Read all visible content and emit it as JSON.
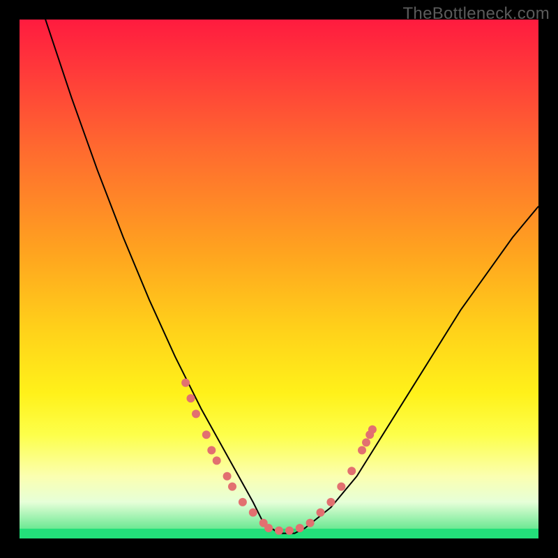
{
  "watermark": "TheBottleneck.com",
  "colors": {
    "gradient_top": "#ff1b3f",
    "gradient_bottom": "#3fe07a",
    "curve": "#000000",
    "points": "#e27070",
    "frame_bg": "#000000"
  },
  "chart_data": {
    "type": "line",
    "title": "",
    "xlabel": "",
    "ylabel": "",
    "xlim": [
      0,
      100
    ],
    "ylim": [
      0,
      100
    ],
    "series": [
      {
        "name": "bottleneck-curve",
        "x": [
          0,
          5,
          10,
          15,
          20,
          25,
          30,
          35,
          40,
          45,
          47,
          50,
          53,
          55,
          60,
          65,
          70,
          75,
          80,
          85,
          90,
          95,
          100
        ],
        "y": [
          120,
          100,
          85,
          71,
          58,
          46,
          35,
          25,
          16,
          7,
          3,
          1,
          1,
          2,
          6,
          12,
          20,
          28,
          36,
          44,
          51,
          58,
          64
        ]
      }
    ],
    "points": [
      {
        "x": 32,
        "y": 30
      },
      {
        "x": 33,
        "y": 27
      },
      {
        "x": 34,
        "y": 24
      },
      {
        "x": 36,
        "y": 20
      },
      {
        "x": 37,
        "y": 17
      },
      {
        "x": 38,
        "y": 15
      },
      {
        "x": 40,
        "y": 12
      },
      {
        "x": 41,
        "y": 10
      },
      {
        "x": 43,
        "y": 7
      },
      {
        "x": 45,
        "y": 5
      },
      {
        "x": 47,
        "y": 3
      },
      {
        "x": 48,
        "y": 2
      },
      {
        "x": 50,
        "y": 1.5
      },
      {
        "x": 52,
        "y": 1.5
      },
      {
        "x": 54,
        "y": 2
      },
      {
        "x": 56,
        "y": 3
      },
      {
        "x": 58,
        "y": 5
      },
      {
        "x": 60,
        "y": 7
      },
      {
        "x": 62,
        "y": 10
      },
      {
        "x": 64,
        "y": 13
      },
      {
        "x": 66,
        "y": 17
      },
      {
        "x": 66.8,
        "y": 18.5
      },
      {
        "x": 67.5,
        "y": 20
      },
      {
        "x": 68,
        "y": 21
      }
    ],
    "annotations": []
  }
}
